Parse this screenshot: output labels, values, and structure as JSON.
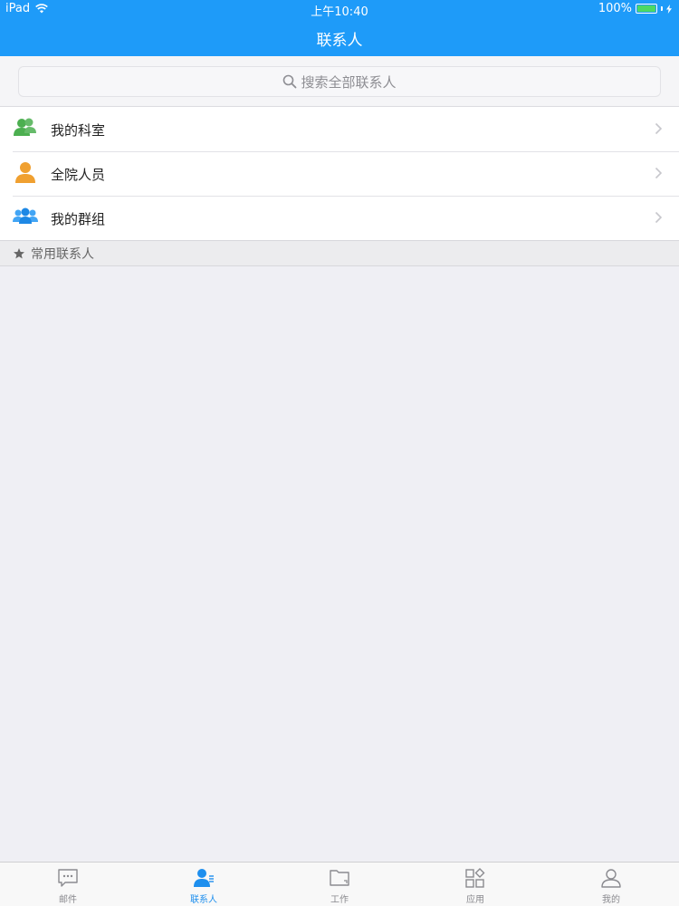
{
  "status_bar": {
    "device": "iPad",
    "time": "上午10:40",
    "battery": "100%",
    "battery_level": 1.0
  },
  "nav": {
    "title": "联系人"
  },
  "search": {
    "placeholder": "搜索全部联系人",
    "icon": "search-icon"
  },
  "menu": [
    {
      "label": "我的科室",
      "icon": "department-icon",
      "icon_color": "#4caf50"
    },
    {
      "label": "全院人员",
      "icon": "person-icon",
      "icon_color": "#f0a030"
    },
    {
      "label": "我的群组",
      "icon": "group-icon",
      "icon_color": "#2196f3"
    }
  ],
  "section": {
    "label": "常用联系人",
    "icon": "star-icon"
  },
  "tabs": [
    {
      "label": "邮件",
      "icon": "mail-icon",
      "active": false
    },
    {
      "label": "联系人",
      "icon": "contacts-icon",
      "active": true
    },
    {
      "label": "工作",
      "icon": "folder-icon",
      "active": false
    },
    {
      "label": "应用",
      "icon": "apps-icon",
      "active": false
    },
    {
      "label": "我的",
      "icon": "profile-icon",
      "active": false
    }
  ],
  "colors": {
    "accent": "#1e9bf9",
    "background": "#efeff4",
    "active_tab": "#1e8fee",
    "inactive_tab": "#8a8a8f"
  }
}
